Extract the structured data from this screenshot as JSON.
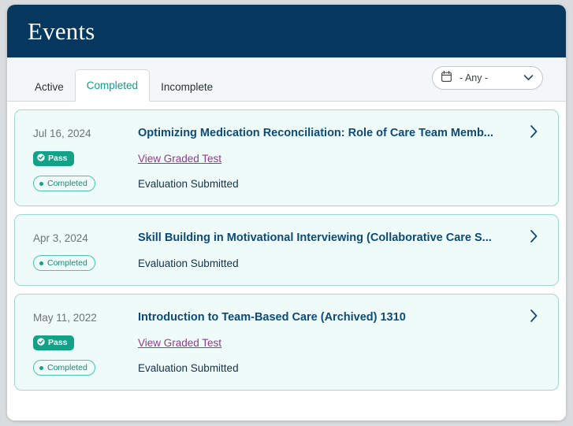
{
  "header": {
    "title": "Events",
    "bg_color": "#05375f"
  },
  "tabs": [
    {
      "label": "Active",
      "active": false
    },
    {
      "label": "Completed",
      "active": true
    },
    {
      "label": "Incomplete",
      "active": false
    }
  ],
  "date_filter": {
    "icon": "calendar-icon",
    "value": "- Any -",
    "chevron": "chevron-down-icon"
  },
  "colors": {
    "accent_teal": "#13a188",
    "navy": "#05375f",
    "title_blue": "#0c4a7a",
    "link_purple": "#8f3a8e",
    "card_bg": "#effbf8",
    "card_border": "#9fd9cf"
  },
  "events": [
    {
      "date": "Jul 16, 2024",
      "title": "Optimizing Medication Reconciliation: Role of Care Team Memb...",
      "pass_badge": "Pass",
      "status_badge": "Completed",
      "graded_link": "View Graded Test",
      "evaluation": "Evaluation Submitted",
      "has_pass": true,
      "has_link": true
    },
    {
      "date": "Apr 3, 2024",
      "title": "Skill Building in Motivational Interviewing (Collaborative Care S...",
      "pass_badge": "",
      "status_badge": "Completed",
      "graded_link": "",
      "evaluation": "Evaluation Submitted",
      "has_pass": false,
      "has_link": false
    },
    {
      "date": "May 11, 2022",
      "title": "Introduction to Team-Based Care (Archived) 1310",
      "pass_badge": "Pass",
      "status_badge": "Completed",
      "graded_link": "View Graded Test",
      "evaluation": "Evaluation Submitted",
      "has_pass": true,
      "has_link": true
    }
  ]
}
